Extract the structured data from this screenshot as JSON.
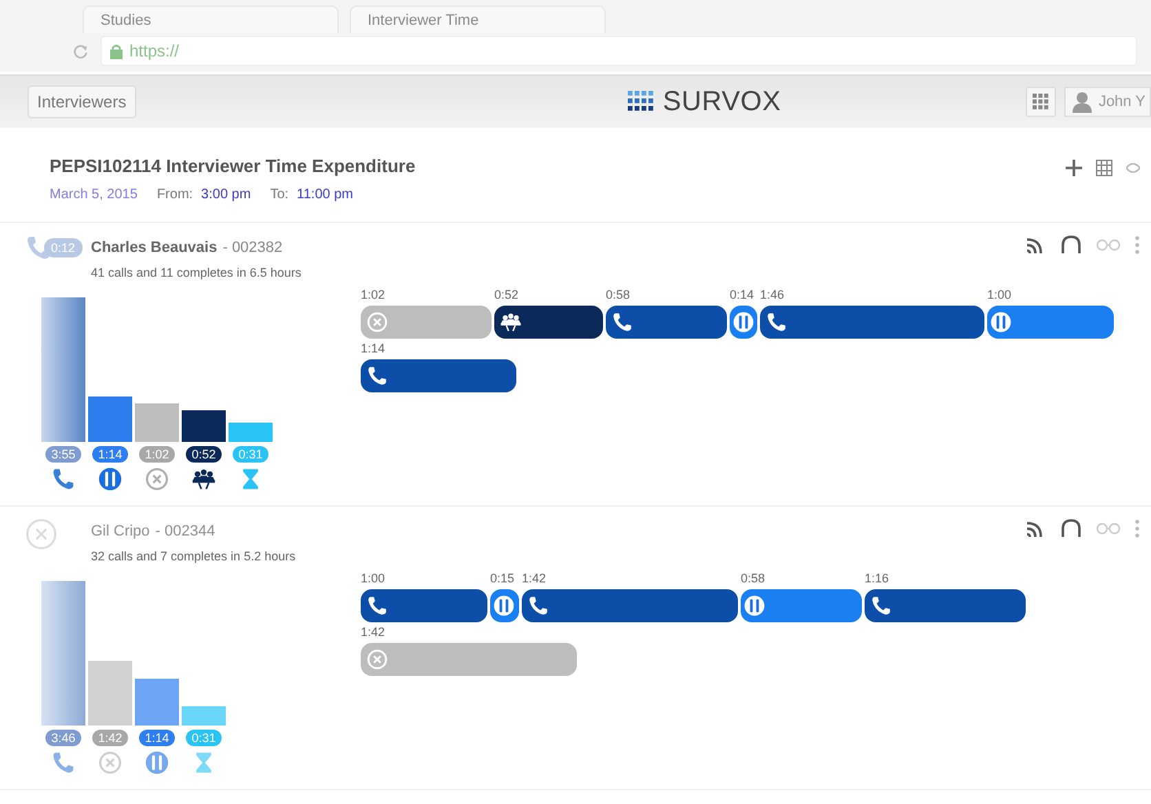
{
  "browser": {
    "tabs": [
      {
        "label": "Studies"
      },
      {
        "label": "Interviewer Time"
      }
    ],
    "address": "https://"
  },
  "app_bar": {
    "back_button": "Interviewers",
    "logo": "SURVOX",
    "user": "John Y"
  },
  "report": {
    "title": "PEPSI102114 Interviewer Time Expenditure",
    "date": "March 5, 2015",
    "from_label": "From:",
    "from": "3:00 pm",
    "to_label": "To:",
    "to": "11:00 pm"
  },
  "interviewers": [
    {
      "name": "Charles Beauvais",
      "id": "- 002382",
      "active": true,
      "on_call": true,
      "badge": "0:12",
      "summary": "41 calls and 11 completes in 6.5 hours",
      "totals": [
        {
          "kind": "call",
          "label": "3:55"
        },
        {
          "kind": "break",
          "label": "1:14"
        },
        {
          "kind": "fail",
          "label": "1:02"
        },
        {
          "kind": "meeting",
          "label": "0:52"
        },
        {
          "kind": "idle",
          "label": "0:31"
        }
      ],
      "timeline": [
        [
          {
            "kind": "fail",
            "label": "1:02"
          },
          {
            "kind": "meeting",
            "label": "0:52"
          },
          {
            "kind": "call",
            "label": "0:58"
          },
          {
            "kind": "break",
            "label": "0:14"
          },
          {
            "kind": "call",
            "label": "1:46"
          },
          {
            "kind": "break",
            "label": "1:00"
          }
        ],
        [
          {
            "kind": "call",
            "label": "1:14"
          }
        ]
      ]
    },
    {
      "name": "Gil Cripo",
      "id": "- 002344",
      "active": false,
      "on_call": false,
      "summary": "32 calls and 7 completes in 5.2 hours",
      "totals": [
        {
          "kind": "call",
          "label": "3:46"
        },
        {
          "kind": "fail",
          "label": "1:42"
        },
        {
          "kind": "break",
          "label": "1:14"
        },
        {
          "kind": "idle",
          "label": "0:31"
        }
      ],
      "timeline": [
        [
          {
            "kind": "call",
            "label": "1:00"
          },
          {
            "kind": "break",
            "label": "0:15"
          },
          {
            "kind": "call",
            "label": "1:42"
          },
          {
            "kind": "break",
            "label": "0:58"
          },
          {
            "kind": "call",
            "label": "1:16"
          }
        ],
        [
          {
            "kind": "fail",
            "label": "1:42"
          }
        ]
      ]
    }
  ]
}
